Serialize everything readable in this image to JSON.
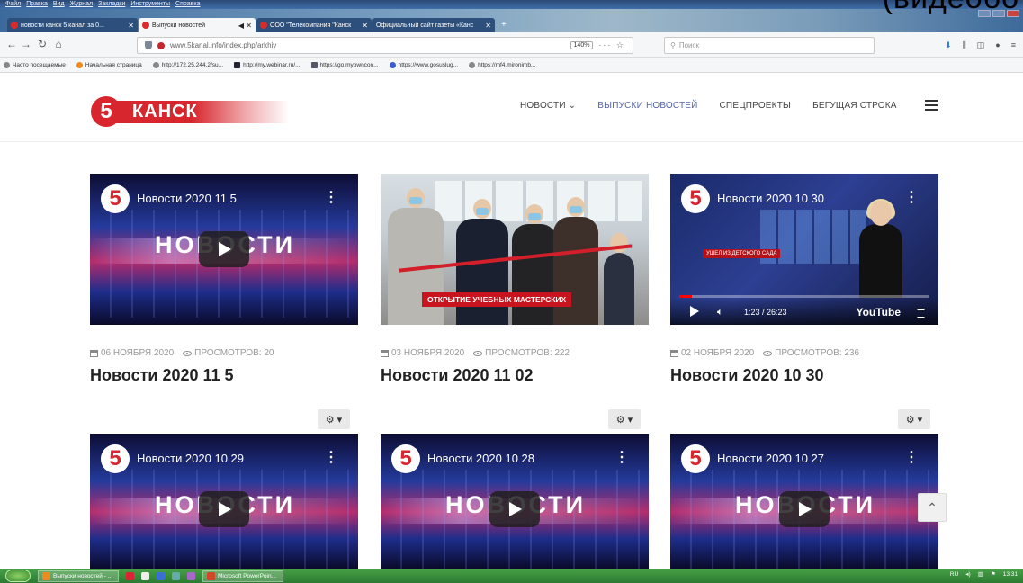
{
  "browser": {
    "menu": [
      "Файл",
      "Правка",
      "Вид",
      "Журнал",
      "Закладки",
      "Инструменты",
      "Справка"
    ],
    "tabs": [
      {
        "label": "новости канск 5 канал за 0...",
        "active": false
      },
      {
        "label": "Выпуски новостей",
        "active": true
      },
      {
        "label": "ООО \"Телекомпания \"Канск",
        "active": false
      },
      {
        "label": "Официальный сайт газеты «Канс",
        "active": false
      }
    ],
    "new_tab": "+",
    "overlay_text": "(видеобо",
    "url": "www.5kanal.info/index.php/arkhiv",
    "zoom": "140%",
    "url_tools": "··· ☆",
    "search_placeholder": "Поиск",
    "bookmarks": [
      "Часто посещаемые",
      "Начальная страница",
      "http://172.25.244.2/su...",
      "http://my.webinar.ru/...",
      "https://go.myowncon...",
      "https://www.gosuslug...",
      "https://mf4.mironimb..."
    ]
  },
  "site": {
    "logo_number": "5",
    "logo_text": "КАНСК",
    "brand_color": "#d7262d",
    "nav": [
      {
        "label": "НОВОСТИ ⌄",
        "active": false
      },
      {
        "label": "ВЫПУСКИ НОВОСТЕЙ",
        "active": true
      },
      {
        "label": "СПЕЦПРОЕКТЫ",
        "active": false
      },
      {
        "label": "БЕГУЩАЯ СТРОКА",
        "active": false
      }
    ],
    "menu_icon": "hamburger-icon"
  },
  "videos": [
    {
      "title": "Новости 2020 11 5",
      "thumb_title": "Новости 2020 11 5",
      "date": "06 НОЯБРЯ 2020",
      "views": "ПРОСМОТРОВ: 20",
      "thumb_word": "НОВОСТИ"
    },
    {
      "title": "Новости 2020 11 02",
      "date": "03 НОЯБРЯ 2020",
      "views": "ПРОСМОТРОВ: 222",
      "lower_third": "ОТКРЫТИЕ УЧЕБНЫХ МАСТЕРСКИХ"
    },
    {
      "title": "Новости 2020 10 30",
      "thumb_title": "Новости 2020 10 30",
      "date": "02 НОЯБРЯ 2020",
      "views": "ПРОСМОТРОВ: 236",
      "banner": "УШЕЛ ИЗ ДЕТСКОГО САДА",
      "time": "1:23 / 26:23",
      "youtube": "YouTube",
      "progress": 0.05
    },
    {
      "thumb_title": "Новости 2020 10 29",
      "thumb_word": "НОВОСТИ"
    },
    {
      "thumb_title": "Новости 2020 10 28",
      "thumb_word": "НОВОСТИ"
    },
    {
      "thumb_title": "Новости 2020 10 27",
      "thumb_word": "НОВОСТИ"
    }
  ],
  "gear_label": "⚙ ▾",
  "scroll_top_icon": "chevron-up-icon",
  "scroll_top_glyph": "⌃",
  "taskbar": {
    "tasks": [
      "Выпуски новостей - ...",
      "Microsoft PowerPoin..."
    ],
    "lang": "RU",
    "clock": "13:31"
  }
}
